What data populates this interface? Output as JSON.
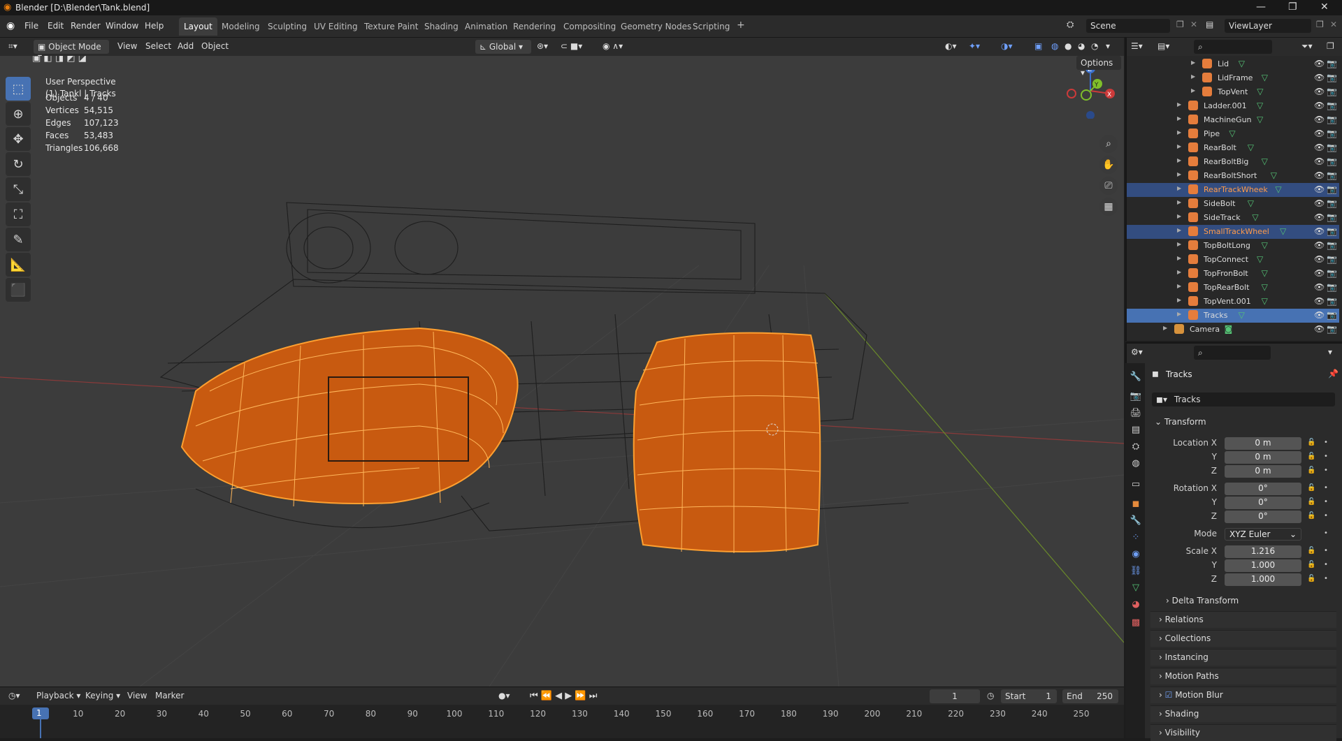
{
  "titlebar": {
    "title": "Blender [D:\\Blender\\Tank.blend]",
    "min": "—",
    "max": "❐",
    "close": "✕"
  },
  "menus": [
    "File",
    "Edit",
    "Render",
    "Window",
    "Help"
  ],
  "workspaces": [
    "Layout",
    "Modeling",
    "Sculpting",
    "UV Editing",
    "Texture Paint",
    "Shading",
    "Animation",
    "Rendering",
    "Compositing",
    "Geometry Nodes",
    "Scripting"
  ],
  "workspace_add": "+",
  "scene": {
    "name": "Scene",
    "view_layer": "ViewLayer"
  },
  "viewport_header": {
    "mode": "Object Mode",
    "items": [
      "View",
      "Select",
      "Add",
      "Object"
    ],
    "transform": "Global",
    "options": "Options"
  },
  "viewport": {
    "perspective": "User Perspective",
    "collection": "(1) Tankl | Tracks",
    "stats": [
      {
        "label": "Objects",
        "value": "4 / 40"
      },
      {
        "label": "Vertices",
        "value": "54,515"
      },
      {
        "label": "Edges",
        "value": "107,123"
      },
      {
        "label": "Faces",
        "value": "53,483"
      },
      {
        "label": "Triangles",
        "value": "106,668"
      }
    ],
    "gizmo": {
      "x": "X",
      "y": "Y",
      "z": "Z"
    }
  },
  "outliner": {
    "rows": [
      {
        "name": "Lid",
        "state": "normal",
        "indent": 1
      },
      {
        "name": "LidFrame",
        "state": "normal",
        "indent": 1
      },
      {
        "name": "TopVent",
        "state": "normal",
        "indent": 1
      },
      {
        "name": "Ladder.001",
        "state": "normal",
        "indent": 0
      },
      {
        "name": "MachineGun",
        "state": "normal",
        "indent": 0
      },
      {
        "name": "Pipe",
        "state": "normal",
        "indent": 0
      },
      {
        "name": "RearBolt",
        "state": "normal",
        "indent": 0
      },
      {
        "name": "RearBoltBig",
        "state": "normal",
        "indent": 0
      },
      {
        "name": "RearBoltShort",
        "state": "normal",
        "indent": 0
      },
      {
        "name": "RearTrackWheek",
        "state": "selected",
        "indent": 0
      },
      {
        "name": "SideBolt",
        "state": "normal",
        "indent": 0
      },
      {
        "name": "SideTrack",
        "state": "normal",
        "indent": 0
      },
      {
        "name": "SmallTrackWheel",
        "state": "selected",
        "indent": 0
      },
      {
        "name": "TopBoltLong",
        "state": "normal",
        "indent": 0
      },
      {
        "name": "TopConnect",
        "state": "normal",
        "indent": 0
      },
      {
        "name": "TopFronBolt",
        "state": "normal",
        "indent": 0
      },
      {
        "name": "TopRearBolt",
        "state": "normal",
        "indent": 0
      },
      {
        "name": "TopVent.001",
        "state": "normal",
        "indent": 0
      },
      {
        "name": "Tracks",
        "state": "active",
        "indent": 0
      },
      {
        "name": "Camera",
        "state": "normal",
        "indent": -1
      }
    ]
  },
  "properties": {
    "object_name": "Tracks",
    "data_name": "Tracks",
    "transform_header": "Transform",
    "location": {
      "label": "Location X",
      "x": "0 m",
      "y": "0 m",
      "z": "0 m"
    },
    "rotation": {
      "label": "Rotation X",
      "x": "0°",
      "y": "0°",
      "z": "0°"
    },
    "mode": {
      "label": "Mode",
      "value": "XYZ Euler"
    },
    "scale": {
      "label": "Scale X",
      "x": "1.216",
      "y": "1.000",
      "z": "1.000"
    },
    "axis": {
      "y": "Y",
      "z": "Z"
    },
    "panels": [
      "Delta Transform",
      "Relations",
      "Collections",
      "Instancing",
      "Motion Paths",
      "Motion Blur",
      "Shading",
      "Visibility"
    ]
  },
  "timeline": {
    "menus": [
      "Playback",
      "Keying",
      "View",
      "Marker"
    ],
    "current_frame": "1",
    "start_label": "Start",
    "start": "1",
    "end_label": "End",
    "end": "250",
    "ticks": [
      "1",
      "10",
      "20",
      "30",
      "40",
      "50",
      "60",
      "70",
      "80",
      "90",
      "100",
      "110",
      "120",
      "130",
      "140",
      "150",
      "160",
      "170",
      "180",
      "190",
      "200",
      "210",
      "220",
      "230",
      "240",
      "250"
    ]
  },
  "colors": {
    "accent": "#4772b3",
    "selected_orange": "#ff8a1c",
    "bg": "#3c3c3c"
  }
}
